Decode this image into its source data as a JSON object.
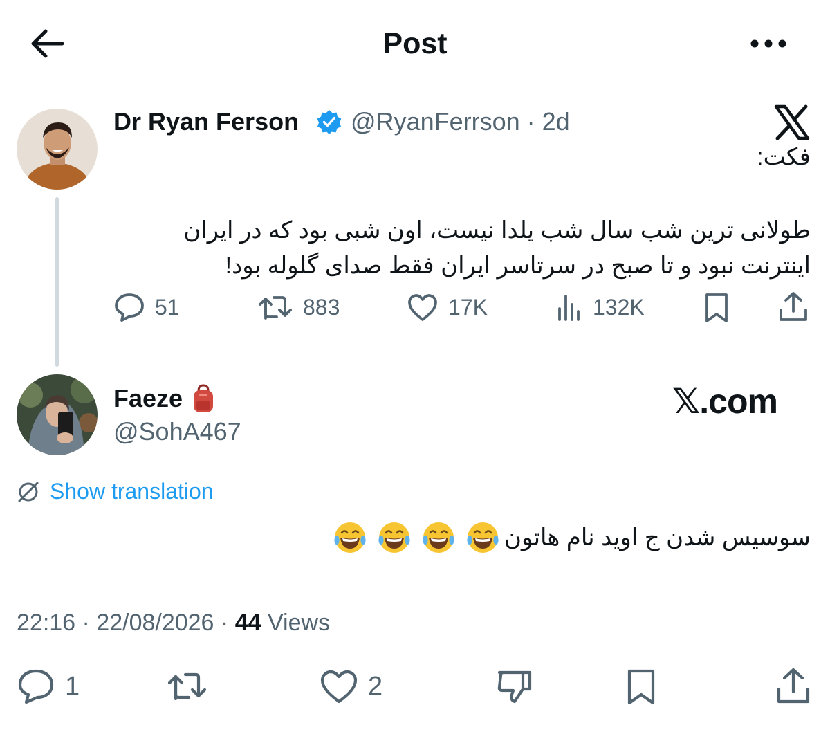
{
  "header": {
    "title": "Post",
    "back_icon": "arrow-left-icon",
    "more_icon": "more-horizontal-icon"
  },
  "parent_tweet": {
    "name": "Dr Ryan Ferson",
    "verified": true,
    "handle_time": "@RyanFerrson · 2d",
    "label": "فکت:",
    "body": "طولانی ترین شب سال شب یلدا نیست، اون شبی بود که در ایران اینترنت نبود و تا صبح در سرتاسر ایران فقط صدای گلوله بود!",
    "replies": "51",
    "reposts": "883",
    "likes": "17K",
    "views": "132K"
  },
  "reply_tweet": {
    "name": "Faeze",
    "name_emoji": "backpack-icon",
    "handle": "@SohA467",
    "watermark": "𝕏.com",
    "show_translation": "Show translation",
    "body_text": "سوسیس شدن ج اوید نام هاتون",
    "emoji_name": "face-with-tears-of-joy-icon",
    "timestamp": "22:16 · 22/08/2026 · ",
    "views_count": "44",
    "views_label": " Views",
    "replies": "1",
    "reposts": "",
    "likes": "2"
  },
  "colors": {
    "text": "#0f1419",
    "secondary": "#536471",
    "accent": "#1d9bf0",
    "thread_line": "#cfd9de"
  }
}
